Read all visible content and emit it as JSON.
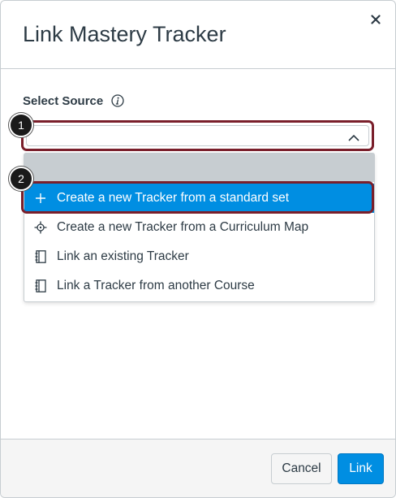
{
  "dialog": {
    "title": "Link Mastery Tracker",
    "close_icon": "close-icon"
  },
  "form": {
    "label": "Select Source",
    "info_icon": "info-icon",
    "select_value": "",
    "expanded": true
  },
  "dropdown": {
    "options": [
      {
        "label": "Create a new Tracker from a standard set",
        "icon": "plus-icon",
        "highlighted": true
      },
      {
        "label": "Create a new Tracker from a Curriculum Map",
        "icon": "target-icon",
        "highlighted": false
      },
      {
        "label": "Link an existing Tracker",
        "icon": "notebook-icon",
        "highlighted": false
      },
      {
        "label": "Link a Tracker from another Course",
        "icon": "notebook-icon",
        "highlighted": false
      }
    ]
  },
  "callouts": [
    "1",
    "2"
  ],
  "footer": {
    "cancel_label": "Cancel",
    "link_label": "Link"
  },
  "colors": {
    "accent": "#008ee2",
    "callout_outline": "#7a1f2b",
    "text": "#2d3b45"
  }
}
